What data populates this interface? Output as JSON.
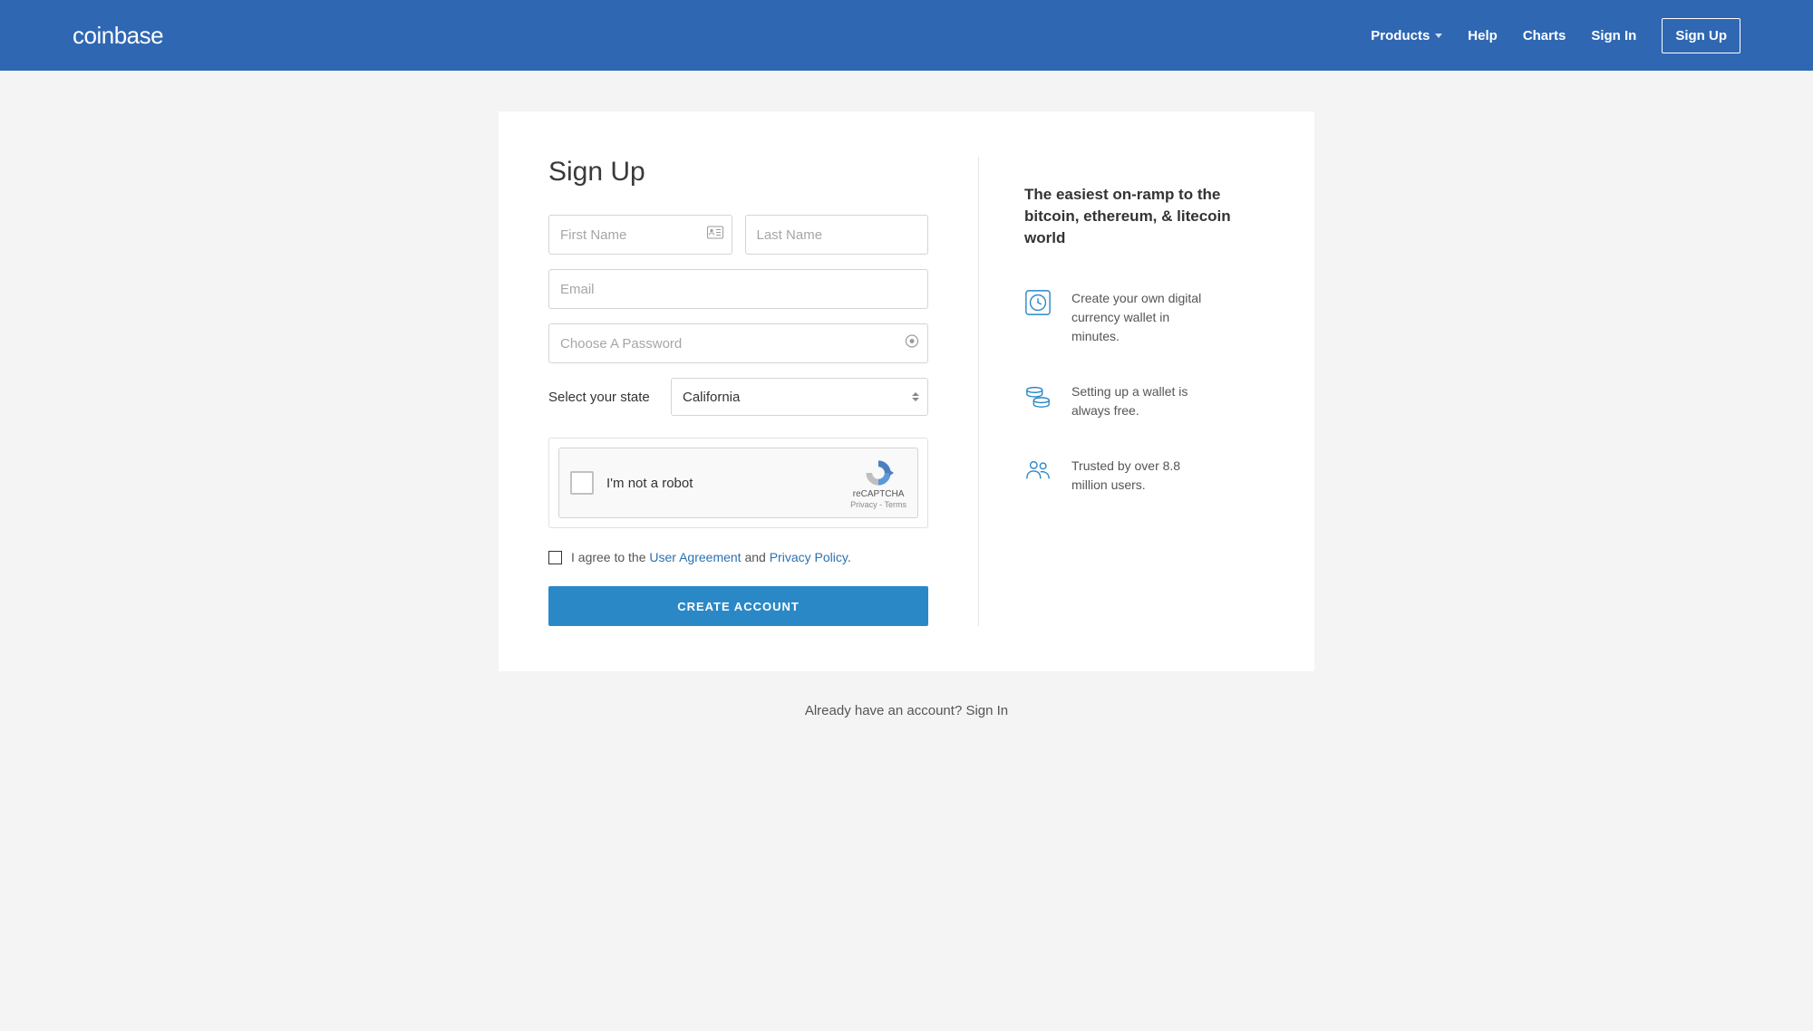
{
  "header": {
    "logo": "coinbase",
    "nav": {
      "products": "Products",
      "help": "Help",
      "charts": "Charts",
      "signin": "Sign In",
      "signup": "Sign Up"
    }
  },
  "form": {
    "title": "Sign Up",
    "first_name_placeholder": "First Name",
    "last_name_placeholder": "Last Name",
    "email_placeholder": "Email",
    "password_placeholder": "Choose A Password",
    "state_label": "Select your state",
    "state_value": "California",
    "recaptcha_label": "I'm not a robot",
    "recaptcha_brand": "reCAPTCHA",
    "recaptcha_links": "Privacy - Terms",
    "agree_prefix": "I agree to the ",
    "agree_link_1": "User Agreement",
    "agree_mid": " and ",
    "agree_link_2": "Privacy Policy",
    "agree_suffix": ".",
    "create_button": "CREATE ACCOUNT"
  },
  "info": {
    "heading": "The easiest on-ramp to the bitcoin, ethereum, & litecoin world",
    "features": [
      "Create your own digital currency wallet in minutes.",
      "Setting up a wallet is always free.",
      "Trusted by over 8.8 million users."
    ]
  },
  "footer": {
    "already_text": "Already have an account? ",
    "signin_link": "Sign In"
  }
}
